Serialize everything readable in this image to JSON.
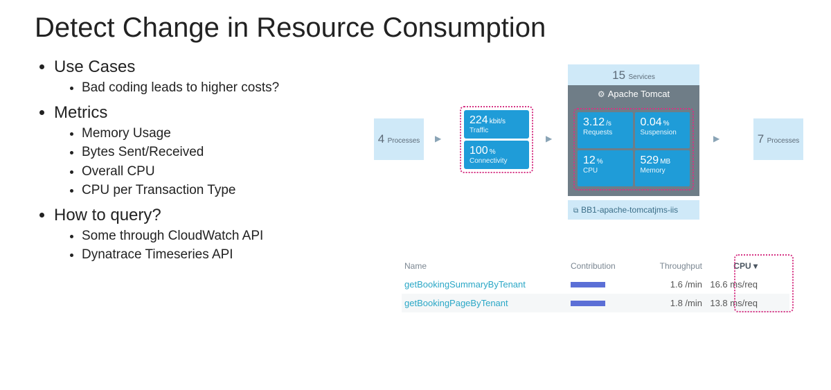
{
  "title": "Detect Change in Resource Consumption",
  "bullets": {
    "use_cases": {
      "label": "Use Cases",
      "items": [
        "Bad coding leads to higher costs?"
      ]
    },
    "metrics": {
      "label": "Metrics",
      "items": [
        "Memory Usage",
        "Bytes Sent/Received",
        "Overall CPU",
        "CPU per Transaction Type"
      ]
    },
    "how": {
      "label": "How to query?",
      "items": [
        "Some through CloudWatch API",
        "Dynatrace Timeseries API"
      ]
    }
  },
  "flow": {
    "left_processes_num": "4",
    "left_processes_label": "Processes",
    "right_processes_num": "7",
    "right_processes_label": "Processes",
    "services_num": "15",
    "services_label": "Services",
    "tomcat_header_icon": "⚙",
    "tomcat_header": "Apache Tomcat",
    "traffic": {
      "rate_val": "224",
      "rate_unit": "kbit/s",
      "rate_label": "Traffic",
      "conn_val": "100",
      "conn_unit": "%",
      "conn_label": "Connectivity"
    },
    "metrics": {
      "requests_val": "3.12",
      "requests_unit": "/s",
      "requests_label": "Requests",
      "suspension_val": "0.04",
      "suspension_unit": "%",
      "suspension_label": "Suspension",
      "cpu_val": "12",
      "cpu_unit": "%",
      "cpu_label": "CPU",
      "memory_val": "529",
      "memory_unit": "MB",
      "memory_label": "Memory"
    },
    "host_icon": "⧉",
    "host_label": "BB1-apache-tomcatjms-iis"
  },
  "table": {
    "headers": {
      "name": "Name",
      "contribution": "Contribution",
      "throughput": "Throughput",
      "cpu": "CPU ▾"
    },
    "rows": [
      {
        "name": "getBookingSummaryByTenant",
        "throughput": "1.6 /min",
        "cpu": "16.6 ms/req"
      },
      {
        "name": "getBookingPageByTenant",
        "throughput": "1.8 /min",
        "cpu": "13.8 ms/req"
      }
    ]
  },
  "chart_data": {
    "type": "table",
    "title": "Transaction CPU consumption",
    "columns": [
      "Name",
      "Throughput",
      "CPU (ms/req)"
    ],
    "rows": [
      [
        "getBookingSummaryByTenant",
        "1.6 /min",
        16.6
      ],
      [
        "getBookingPageByTenant",
        "1.8 /min",
        13.8
      ]
    ]
  }
}
